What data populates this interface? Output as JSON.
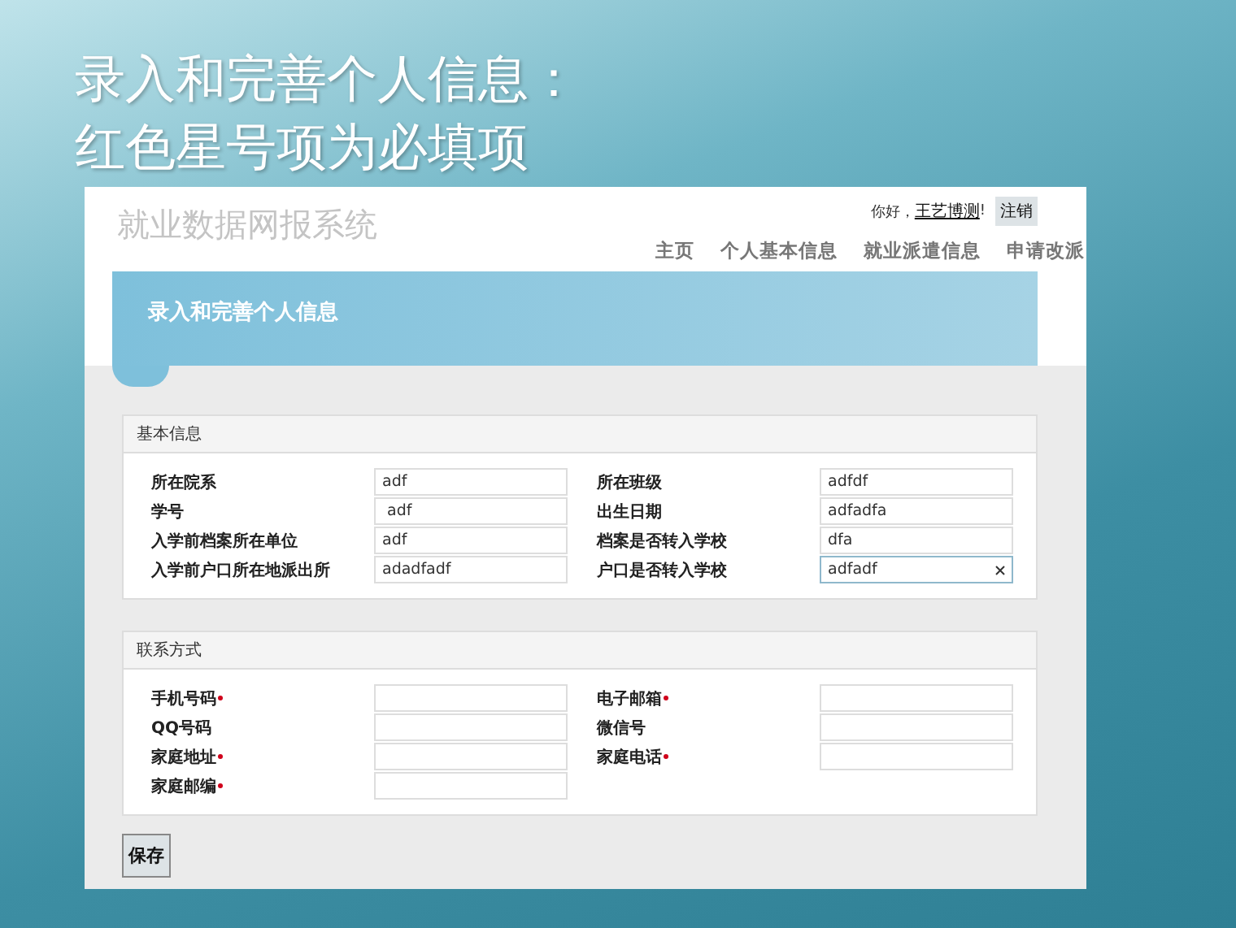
{
  "slide": {
    "title_lines": [
      "录入和完善个人信息：",
      "红色星号项为必填项"
    ]
  },
  "app": {
    "logo": "就业数据网报系统",
    "greeting": "你好，",
    "user": "王艺博测",
    "user_suffix": "!",
    "logout": "注销",
    "nav": [
      {
        "label": "主页",
        "selected": false
      },
      {
        "label": "个人基本信息",
        "selected": false
      },
      {
        "label": "就业派遣信息",
        "selected": false
      },
      {
        "label": "申请改派",
        "selected": false
      }
    ],
    "banner": "录入和完善个人信息",
    "sections": [
      {
        "title": "基本信息",
        "fields": [
          {
            "label": "所在院系",
            "value": "adf",
            "required": false,
            "focused": false
          },
          {
            "label": "所在班级",
            "value": "adfdf",
            "required": false,
            "focused": false
          },
          {
            "label": "学号",
            "value": " adf",
            "required": false,
            "focused": false
          },
          {
            "label": "出生日期",
            "value": "adfadfa",
            "required": false,
            "focused": false
          },
          {
            "label": "入学前档案所在单位",
            "value": "adf",
            "required": false,
            "focused": false
          },
          {
            "label": "档案是否转入学校",
            "value": "dfa",
            "required": false,
            "focused": false
          },
          {
            "label": "入学前户口所在地派出所",
            "value": "adadfadf",
            "required": false,
            "focused": false
          },
          {
            "label": "户口是否转入学校",
            "value": "adfadf",
            "required": false,
            "focused": true
          }
        ]
      },
      {
        "title": "联系方式",
        "fields": [
          {
            "label": "手机号码",
            "required": true,
            "focused": false
          },
          {
            "label": "电子邮箱",
            "required": true,
            "focused": false
          },
          {
            "label": "QQ号码",
            "required": false,
            "focused": false
          },
          {
            "label": "微信号",
            "required": false,
            "focused": false
          },
          {
            "label": "家庭地址",
            "required": true,
            "focused": false
          },
          {
            "label": "家庭电话",
            "required": true,
            "focused": false
          },
          {
            "label": "家庭邮编",
            "required": true,
            "focused": false
          }
        ]
      }
    ],
    "save": "保存"
  }
}
